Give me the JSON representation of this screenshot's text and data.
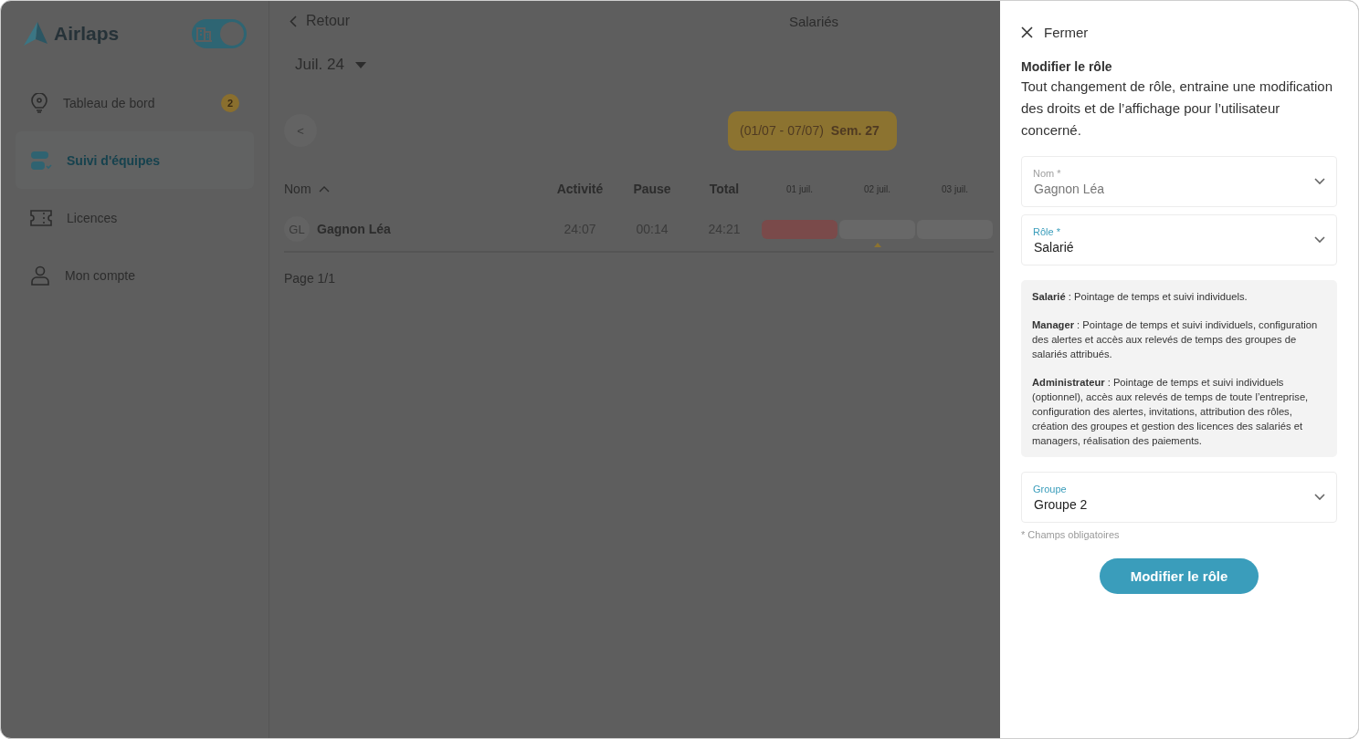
{
  "sidebar": {
    "logo": {
      "text": "Airlaps"
    },
    "toggle": {
      "on": true
    },
    "items": [
      {
        "label": "Tableau de bord",
        "kind": "bulb",
        "badge": "2",
        "selected": false
      },
      {
        "label": "Suivi d'équipes",
        "kind": "teams",
        "selected": true
      },
      {
        "label": "Licences",
        "kind": "ticket",
        "selected": false
      },
      {
        "label": "Mon compte",
        "kind": "user",
        "selected": false
      }
    ]
  },
  "header": {
    "back": "Retour",
    "title": "Salariés"
  },
  "month_selector": {
    "value": "Juil. 24"
  },
  "week": {
    "prev": "<",
    "range": "(01/07 - 07/07)",
    "label": "Sem. 27"
  },
  "table": {
    "columns": [
      {
        "label": "Nom",
        "sorted": true
      },
      {
        "label": "Activité"
      },
      {
        "label": "Pause"
      },
      {
        "label": "Total"
      }
    ],
    "days": [
      {
        "label": "01 juil."
      },
      {
        "label": "02 juil."
      },
      {
        "label": "03 juil."
      }
    ],
    "rows": [
      {
        "initials": "GL",
        "name": "Gagnon Léa",
        "activity": "24:07",
        "pause": "00:14",
        "total": "24:21",
        "cells": [
          {
            "color": "#7a4a4a",
            "marker": false
          },
          {
            "color": "#686868",
            "marker": true
          },
          {
            "color": "#686868",
            "marker": false
          }
        ]
      }
    ],
    "pagination": "Page 1/1"
  },
  "drawer": {
    "close": "Fermer",
    "title": "Modifier le rôle",
    "description": "Tout changement de rôle, entraine une modification des droits et de l’affichage pour l’utilisateur concerné.",
    "fields": [
      {
        "label": "Nom *",
        "value": "Gagnon Léa",
        "disabled": true
      },
      {
        "label": "Rôle *",
        "value": "Salarié",
        "disabled": false
      }
    ],
    "info": [
      "**Salarié** : Pointage de temps et suivi individuels.",
      "**Manager** : Pointage de temps et suivi individuels, configuration des alertes et accès aux relevés de temps des groupes de salariés attribués.",
      "**Administrateur** : Pointage de temps et suivi individuels (optionnel), accès aux relevés de temps de toute l’entreprise, configuration des alertes, invitations, attribution des rôles, création des groupes et gestion des licences des salariés et managers, réalisation des paiements."
    ],
    "group_field": {
      "label": "Groupe",
      "value": "Groupe 2",
      "disabled": false
    },
    "required_note": "* Champs obligatoires",
    "submit": "Modifier le rôle"
  }
}
